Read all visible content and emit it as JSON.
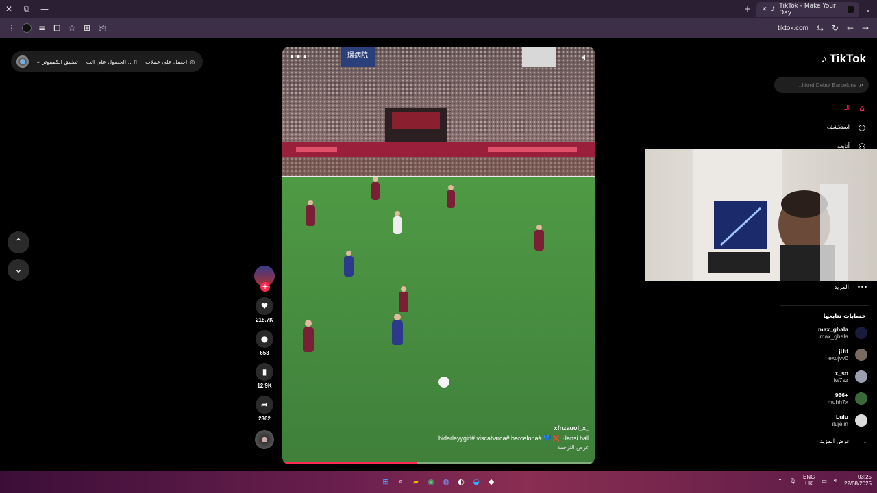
{
  "browser": {
    "tab_title": "TikTok - Make Your Day",
    "url": "tiktok.com"
  },
  "promo": {
    "item1": "احصل على عملات",
    "item2": "الحصول على الت...",
    "item3": "تطبيق الكمبيوتر"
  },
  "video": {
    "author": "xfnzauol_x_",
    "caption": "bidarleyygirl#  viscabarca#  barcelona# 💙 ❌ Hansi ball",
    "translate": "عرض الترجمة",
    "progress": 0.43,
    "stands_sign": "環病院"
  },
  "actions": {
    "likes": "218.7K",
    "comments": "653",
    "saves": "12.9K",
    "shares": "2362"
  },
  "sidebar": {
    "logo": "TikTok",
    "search_placeholder": "...hford Debut Barcelona",
    "home_label": "الـ",
    "explore": "استكشف",
    "following": "أتابعه",
    "more": "المزيد",
    "following_accounts_title": "حسابات تتابعها",
    "see_more": "عرض المزيد",
    "accounts": [
      {
        "name": "max_ghala",
        "handle": "max_ghala"
      },
      {
        "name": "jUd",
        "handle": "exojvv0"
      },
      {
        "name": "x_so",
        "handle": "iw7sz"
      },
      {
        "name": "966+",
        "handle": "muhh7x"
      },
      {
        "name": "Lulu",
        "handle": "ilujeiin"
      }
    ]
  },
  "taskbar": {
    "lang1": "ENG",
    "lang2": "UK",
    "time": "03:25",
    "date": "22/08/2025"
  },
  "colors": {
    "accent": "#fe2c55",
    "chrome": "#3d2f47"
  }
}
